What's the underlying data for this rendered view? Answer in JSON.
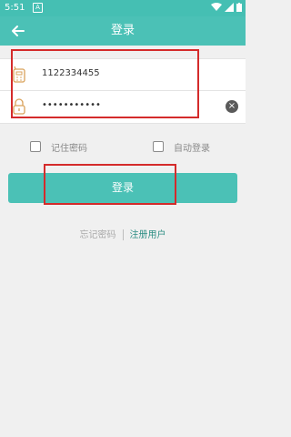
{
  "status_bar": {
    "time": "5:51",
    "notif_icon": "A"
  },
  "app_bar": {
    "title": "登录"
  },
  "form": {
    "username_value": "1122334455",
    "password_value": "•••••••••••"
  },
  "options": {
    "remember_password": "记住密码",
    "auto_login": "自动登录"
  },
  "login_button": "登录",
  "links": {
    "forgot_password": "忘记密码",
    "register": "注册用户"
  },
  "colors": {
    "accent": "#4bc1b6",
    "highlight": "#d42b2b"
  }
}
